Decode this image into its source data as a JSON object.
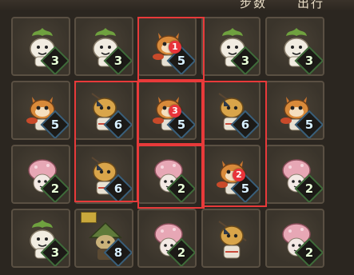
{
  "header": {
    "steps_label": "步数",
    "out_label": "出行"
  },
  "colors": {
    "highlight": "#e83a3a",
    "radish_green": "#6fa13f",
    "raccoon_orange": "#d98a3a",
    "mushroom_pink": "#e7a7b5",
    "badge_green": "#3f6b3a",
    "badge_blue": "#3a5f7a"
  },
  "grid": [
    [
      {
        "char": "radish",
        "value": "3"
      },
      {
        "char": "radish",
        "value": "3"
      },
      {
        "char": "raccoon",
        "value": "5",
        "marker": "1"
      },
      {
        "char": "radish",
        "value": "3"
      },
      {
        "char": "radish",
        "value": "3"
      }
    ],
    [
      {
        "char": "raccoon",
        "value": "5"
      },
      {
        "char": "fisher",
        "value": "6"
      },
      {
        "char": "raccoon",
        "value": "5",
        "marker": "3"
      },
      {
        "char": "fisher",
        "value": "6"
      },
      {
        "char": "raccoon",
        "value": "5"
      }
    ],
    [
      {
        "char": "mushroom",
        "value": "2"
      },
      {
        "char": "fisher",
        "value": "6"
      },
      {
        "char": "mushroom",
        "value": "2"
      },
      {
        "char": "raccoon",
        "value": "5",
        "marker": "2"
      },
      {
        "char": "mushroom",
        "value": "2"
      }
    ],
    [
      {
        "char": "radish",
        "value": "3"
      },
      {
        "char": "wizard",
        "value": "8",
        "flag": true
      },
      {
        "char": "mushroom",
        "value": "2"
      },
      {
        "char": "fisher",
        "value": ""
      },
      {
        "char": "mushroom",
        "value": "2"
      }
    ]
  ]
}
